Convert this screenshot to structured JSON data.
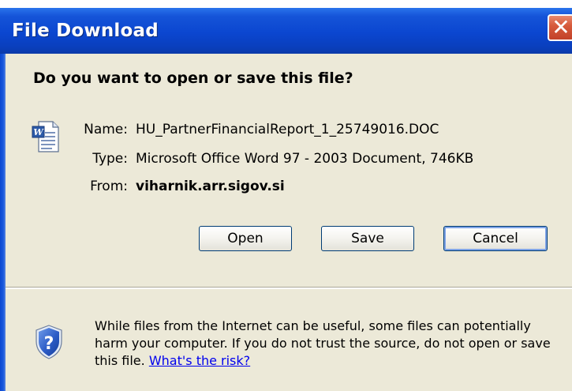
{
  "window": {
    "title": "File Download",
    "close_glyph": "✕"
  },
  "prompt": {
    "question": "Do you want to open or save this file?"
  },
  "file": {
    "icon": "word-document-icon",
    "name_label": "Name:",
    "name_value": "HU_PartnerFinancialReport_1_25749016.DOC",
    "type_label": "Type:",
    "type_value": "Microsoft Office Word 97 - 2003 Document, 746KB",
    "from_label": "From:",
    "from_value": "viharnik.arr.sigov.si"
  },
  "buttons": {
    "open_label": "Open",
    "save_label": "Save",
    "cancel_label": "Cancel"
  },
  "warning": {
    "icon": "security-shield-question-icon",
    "text": "While files from the Internet can be useful, some files can potentially harm your computer. If you do not trust the source, do not open or save this file.",
    "link_text": "What's the risk?"
  },
  "colors": {
    "titlebar": "#0b46d0",
    "dialog_bg": "#ece9d8",
    "close_button": "#d75b3c",
    "link": "#0000ee"
  }
}
